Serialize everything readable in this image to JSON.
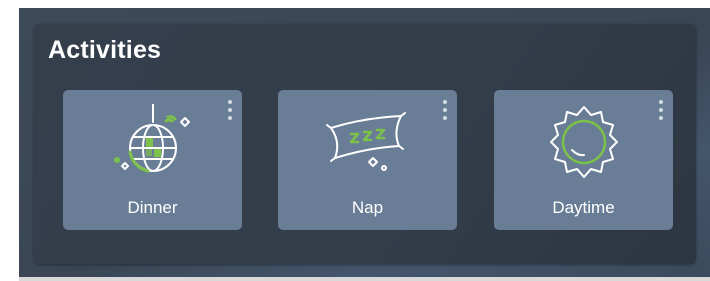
{
  "panel": {
    "title": "Activities"
  },
  "tiles": [
    {
      "label": "Dinner",
      "icon": "disco-ball-icon"
    },
    {
      "label": "Nap",
      "icon": "pillow-icon"
    },
    {
      "label": "Daytime",
      "icon": "sun-icon"
    }
  ],
  "colors": {
    "background": "#3d4a5a",
    "panel": "#333d4a",
    "tile": "#6a7d96",
    "accent": "#7cc24a",
    "text": "#ffffff"
  }
}
